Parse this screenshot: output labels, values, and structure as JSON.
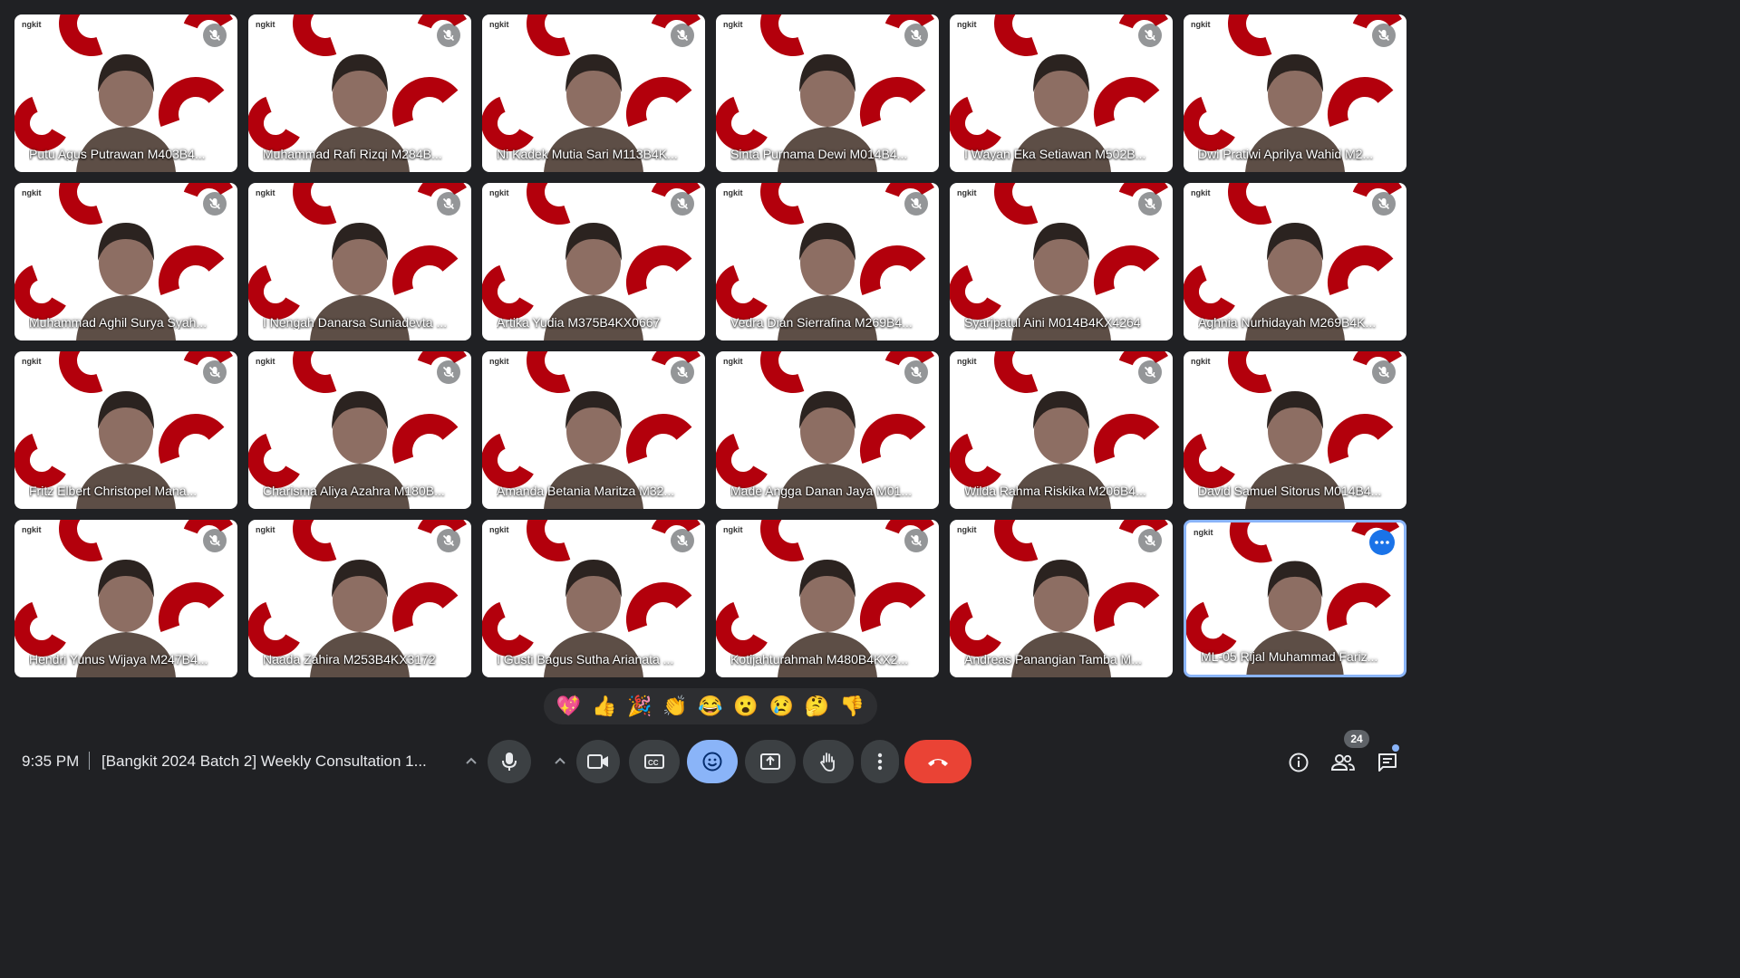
{
  "participants": [
    {
      "name": "Putu Agus Putrawan M403B4..."
    },
    {
      "name": "Muhammad Rafi Rizqi M284B..."
    },
    {
      "name": "Ni Kadek Mutia Sari M113B4K..."
    },
    {
      "name": "Sinta Purnama Dewi M014B4..."
    },
    {
      "name": "I Wayan Eka Setiawan M502B..."
    },
    {
      "name": "Dwi Pratiwi Aprilya Wahid M2..."
    },
    {
      "name": "Muhammad Aghil Surya Syah..."
    },
    {
      "name": "I Nengah Danarsa Suniadevta ..."
    },
    {
      "name": "Artika Yudia M375B4KX0667"
    },
    {
      "name": "Vedra Dian Sierrafina M269B4..."
    },
    {
      "name": "Syaripatul Aini M014B4KX4264"
    },
    {
      "name": "Aghnia Nurhidayah M269B4K..."
    },
    {
      "name": "Fritz Elbert Christopel Mana..."
    },
    {
      "name": "Charisma Aliya Azahra M180B..."
    },
    {
      "name": "Amanda Betania Maritza M32..."
    },
    {
      "name": "Made Angga Danan Jaya M01..."
    },
    {
      "name": "Wilda Rahma Riskika M206B4..."
    },
    {
      "name": "David Samuel Sitorus M014B4..."
    },
    {
      "name": "Hendri Yunus Wijaya M247B4..."
    },
    {
      "name": "Naada Zahira M253B4KX3172"
    },
    {
      "name": "I Gusti Bagus Sutha Arianata ..."
    },
    {
      "name": "Kotijahturahmah M480B4KX2..."
    },
    {
      "name": "Andreas Panangian Tamba M..."
    },
    {
      "name": "ML-05 Rijal Muhammad Fariz..."
    }
  ],
  "background_logo_text": "ngkit",
  "reactions": [
    "💖",
    "👍",
    "🎉",
    "👏",
    "😂",
    "😮",
    "😢",
    "🤔",
    "👎"
  ],
  "meeting": {
    "time": "9:35 PM",
    "title": "[Bangkit 2024 Batch 2] Weekly Consultation 1...",
    "participant_count": "24"
  },
  "colors": {
    "background": "#202124",
    "control_bg": "#3c4043",
    "accent_blue": "#8ab4f8",
    "end_call_red": "#ea4335",
    "logo_red": "#b3000c"
  },
  "controls": {
    "mic_icon": "mic-icon",
    "camera_icon": "camera-icon",
    "captions_icon": "captions-icon",
    "emoji_icon": "emoji-icon",
    "present_icon": "present-icon",
    "hand_icon": "raise-hand-icon",
    "more_icon": "more-vert-icon",
    "end_icon": "end-call-icon",
    "info_icon": "info-icon",
    "people_icon": "people-icon",
    "chat_icon": "chat-icon"
  }
}
